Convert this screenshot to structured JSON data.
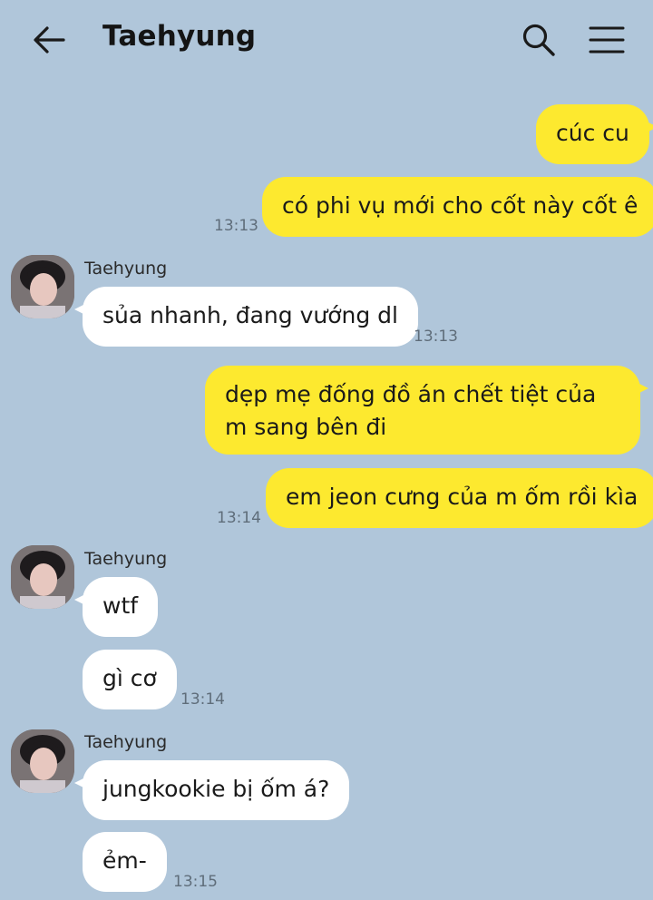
{
  "header": {
    "title": "Taehyung"
  },
  "icons": {
    "back": "arrow-left-icon",
    "search": "search-icon",
    "menu": "hamburger-menu-icon"
  },
  "colors": {
    "background": "#b0c6da",
    "my_bubble": "#fde92f",
    "their_bubble": "#ffffff"
  },
  "messages": [
    {
      "side": "me",
      "text": "cúc cu"
    },
    {
      "side": "me",
      "text": "có phi vụ mới cho cốt này cốt ê",
      "time": "13:13"
    },
    {
      "side": "them",
      "sender": "Taehyung",
      "text": "sủa nhanh, đang vướng dl",
      "time": "13:13"
    },
    {
      "side": "me",
      "text": "dẹp mẹ đống đồ án chết tiệt của m sang bên đi"
    },
    {
      "side": "me",
      "text": "em jeon cưng của m ốm rồi kìa",
      "time": "13:14"
    },
    {
      "side": "them",
      "sender": "Taehyung",
      "text": "wtf"
    },
    {
      "side": "them",
      "text": "gì cơ",
      "time": "13:14"
    },
    {
      "side": "them",
      "sender": "Taehyung",
      "text": "jungkookie bị ốm á?"
    },
    {
      "side": "them",
      "text": "ẻm-",
      "time": "13:15"
    }
  ]
}
